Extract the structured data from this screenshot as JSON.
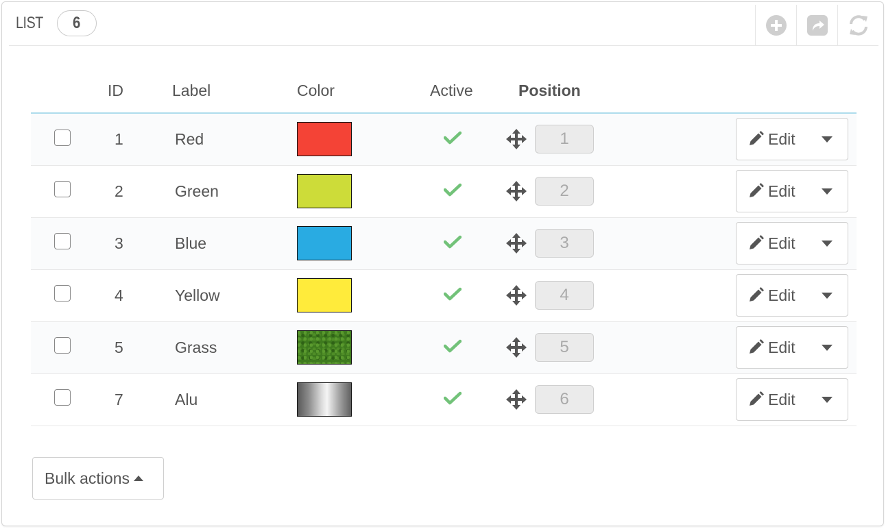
{
  "panel": {
    "title": "LIST",
    "count": "6",
    "actions": [
      {
        "icon": "add-new-icon"
      },
      {
        "icon": "export-icon"
      },
      {
        "icon": "refresh-icon"
      }
    ]
  },
  "table": {
    "columns": [
      "ID",
      "Label",
      "Color",
      "Active",
      "Position"
    ],
    "rows": [
      {
        "id": "1",
        "label": "Red",
        "color": "#f44336",
        "swatch": "solid",
        "active": true,
        "position": "1",
        "edit": "Edit"
      },
      {
        "id": "2",
        "label": "Green",
        "color": "#cddc39",
        "swatch": "solid",
        "active": true,
        "position": "2",
        "edit": "Edit"
      },
      {
        "id": "3",
        "label": "Blue",
        "color": "#29abe2",
        "swatch": "solid",
        "active": true,
        "position": "3",
        "edit": "Edit"
      },
      {
        "id": "4",
        "label": "Yellow",
        "color": "#ffeb3b",
        "swatch": "solid",
        "active": true,
        "position": "4",
        "edit": "Edit"
      },
      {
        "id": "5",
        "label": "Grass",
        "color": "#3e7a1e",
        "swatch": "texture-grass",
        "active": true,
        "position": "5",
        "edit": "Edit"
      },
      {
        "id": "7",
        "label": "Alu",
        "color": "#b0b0b0",
        "swatch": "texture-aluminium",
        "active": true,
        "position": "6",
        "edit": "Edit"
      }
    ]
  },
  "bulk_actions": {
    "label": "Bulk actions"
  },
  "colors": {
    "check": "#72c279",
    "header_border": "#aedcec",
    "icon_grey": "#cfcfcf"
  }
}
